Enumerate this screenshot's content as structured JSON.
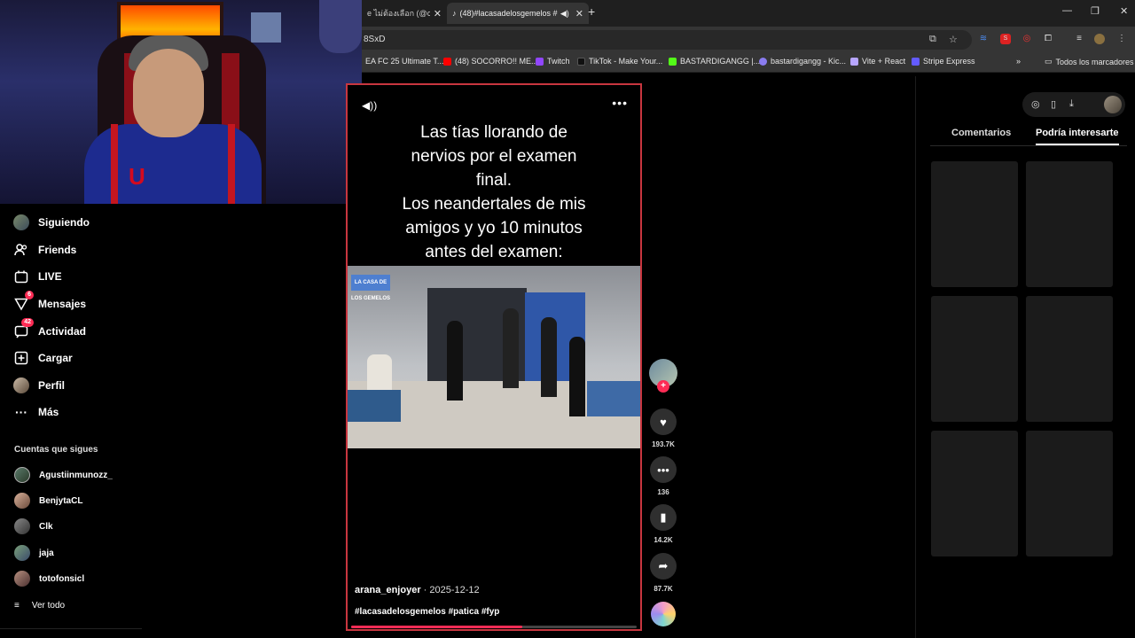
{
  "browser": {
    "tabs": [
      {
        "label": "e ไม่ต้องเลือก (@co",
        "active": false
      },
      {
        "label": "(48)#lacasadelosgemelos #",
        "active": true
      }
    ],
    "url_fragment": "8SxD",
    "bookmarks": [
      {
        "label": "EA FC 25 Ultimate T...",
        "color": "#3a3a3a"
      },
      {
        "label": "(48) SOCORRO!! ME...",
        "color": "#ff0000"
      },
      {
        "label": "Twitch",
        "color": "#9146ff"
      },
      {
        "label": "TikTok - Make Your...",
        "color": "#111111"
      },
      {
        "label": "BASTARDIGANGG |...",
        "color": "#53fc18"
      },
      {
        "label": "bastardigangg - Kic...",
        "color": "#8a7cf0"
      },
      {
        "label": "Vite + React",
        "color": "#b7a6ff"
      },
      {
        "label": "Stripe Express",
        "color": "#635bff"
      },
      {
        "label": "Todos los marcadores",
        "color": "#888888"
      }
    ]
  },
  "sidebar": {
    "items": [
      {
        "label": "Siguiendo",
        "icon": "following-avatar-icon"
      },
      {
        "label": "Friends",
        "icon": "friends-icon"
      },
      {
        "label": "LIVE",
        "icon": "live-icon"
      },
      {
        "label": "Mensajes",
        "icon": "messages-icon",
        "badge": "6"
      },
      {
        "label": "Actividad",
        "icon": "activity-icon",
        "badge": "42"
      },
      {
        "label": "Cargar",
        "icon": "upload-icon"
      },
      {
        "label": "Perfil",
        "icon": "profile-avatar-icon"
      },
      {
        "label": "Más",
        "icon": "more-icon"
      }
    ],
    "following_title": "Cuentas que sigues",
    "following": [
      {
        "name": "Agustiinmunozz_"
      },
      {
        "name": "BenjytaCL"
      },
      {
        "name": "Clk"
      },
      {
        "name": "jaja"
      },
      {
        "name": "totofonsicl"
      }
    ],
    "see_all": "Ver todo"
  },
  "video": {
    "overlay_lines": [
      "Las tías llorando de",
      "nervios por el examen",
      "final.",
      "Los neandertales de mis",
      "amigos y yo 10 minutos",
      "antes del examen:"
    ],
    "clip_logo": "LA CASA DE LOS GEMELOS",
    "author": "arana_enjoyer",
    "date": "· 2025-12-12",
    "hashtags": "#lacasadelosgemelos #patica #fyp",
    "progress": 0.6
  },
  "actions": {
    "likes": "193.7K",
    "comments": "136",
    "saves": "14.2K",
    "shares": "87.7K"
  },
  "right_panel": {
    "tabs": [
      {
        "label": "Comentarios",
        "active": false
      },
      {
        "label": "Podría interesarte",
        "active": true
      }
    ]
  }
}
